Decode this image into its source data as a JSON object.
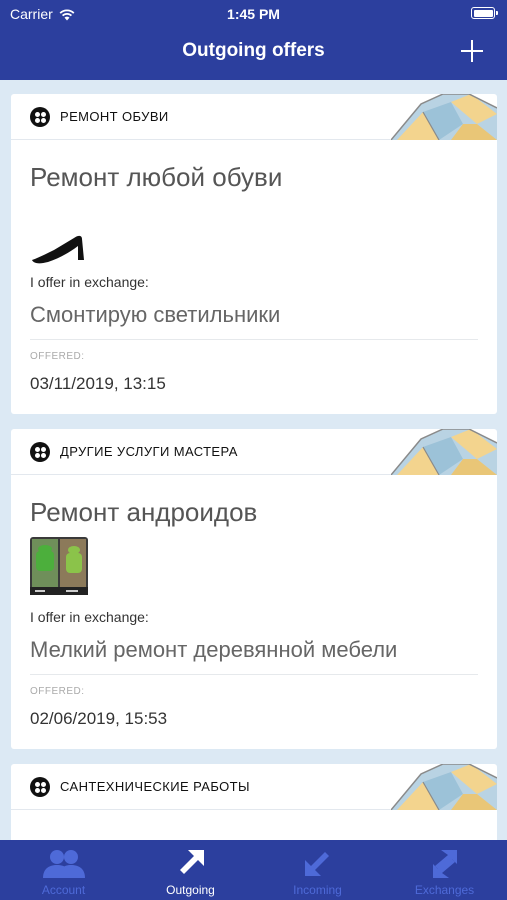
{
  "status_bar": {
    "carrier": "Carrier",
    "time": "1:45 PM"
  },
  "header": {
    "title": "Outgoing offers"
  },
  "offers": [
    {
      "category": "РЕМОНТ ОБУВИ",
      "title": "Ремонт любой обуви",
      "thumb_icon": "shoe-icon",
      "offer_label": "I offer in exchange:",
      "offer_value": "Смонтирую светильники",
      "offered_label": "OFFERED:",
      "offered_date": "03/11/2019, 13:15"
    },
    {
      "category": "ДРУГИЕ УСЛУГИ МАСТЕРА",
      "title": "Ремонт андроидов",
      "thumb_icon": "android-photo",
      "offer_label": "I offer in exchange:",
      "offer_value": "Мелкий ремонт деревянной мебели",
      "offered_label": "OFFERED:",
      "offered_date": "02/06/2019, 15:53"
    },
    {
      "category": "САНТЕХНИЧЕСКИЕ РАБОТЫ"
    }
  ],
  "tabbar": {
    "items": [
      {
        "label": "Account",
        "icon": "users-icon",
        "active": false
      },
      {
        "label": "Outgoing",
        "icon": "arrow-up-right-icon",
        "active": true
      },
      {
        "label": "Incoming",
        "icon": "arrow-down-left-icon",
        "active": false
      },
      {
        "label": "Exchanges",
        "icon": "exchange-arrows-icon",
        "active": false
      }
    ]
  },
  "colors": {
    "primary": "#2c3f9e",
    "background": "#dce9f4",
    "tab_inactive": "#4e6ad8"
  }
}
